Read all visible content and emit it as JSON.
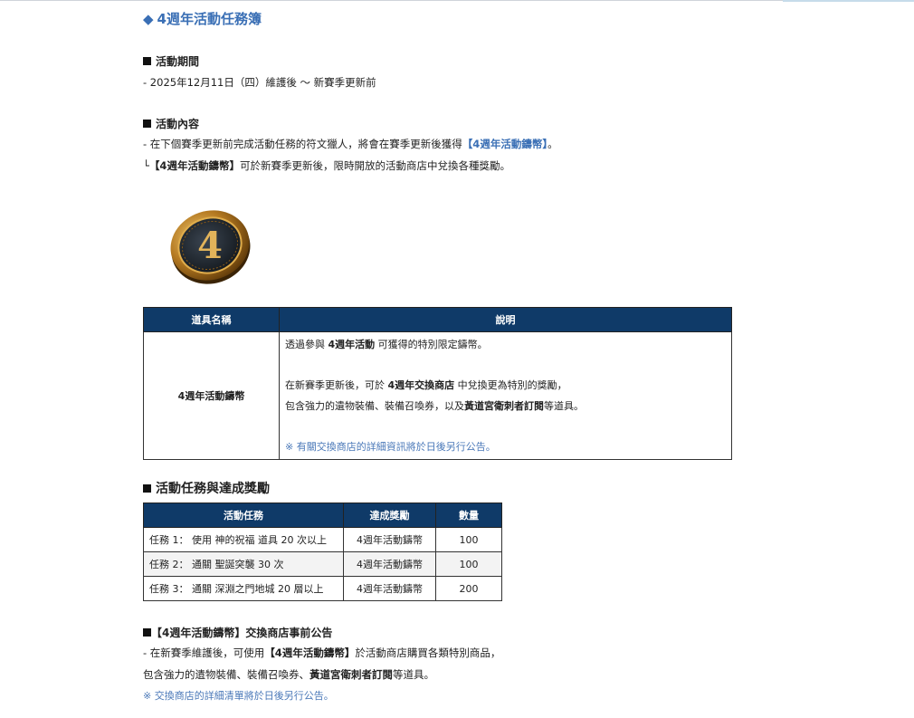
{
  "title": {
    "diamond": "◆",
    "text": "4週年活動任務簿"
  },
  "period": {
    "heading": "活動期間",
    "text": "- 2025年12月11日（四）維護後 ～ 新賽季更新前"
  },
  "content": {
    "heading": "活動內容",
    "line1_prefix": "- 在下個賽季更新前完成活動任務的符文獵人，將會在賽季更新後獲得",
    "line1_highlight": "【4週年活動鑄幣】",
    "line1_suffix": "。",
    "line2_prefix": "└",
    "line2_bold": "【4週年活動鑄幣】",
    "line2_suffix": "可於新賽季更新後，限時開放的活動商店中兌換各種獎勵。"
  },
  "coin": {
    "icon": "anniversary-coin-4",
    "numeral": "4",
    "gold": "#c8902f",
    "dark": "#1c2228"
  },
  "item_table": {
    "headers": [
      "道具名稱",
      "說明"
    ],
    "name": "4週年活動鑄幣",
    "desc1_a": "透過參與 ",
    "desc1_b": "4週年活動",
    "desc1_c": " 可獲得的特別限定鑄幣。",
    "desc2_a": "在新賽季更新後，可於 ",
    "desc2_b": "4週年交換商店",
    "desc2_c": " 中兌換更為特別的獎勵，",
    "desc3_a": "包含強力的遺物裝備、裝備召喚券，以及",
    "desc3_b": "黃道宮衛刺者訂閱",
    "desc3_c": "等道具。",
    "note": "※ 有關交換商店的詳細資訊將於日後另行公告。"
  },
  "missions": {
    "heading": "活動任務與達成獎勵",
    "headers": [
      "活動任務",
      "達成獎勵",
      "數量"
    ],
    "rows": [
      {
        "task": "任務 1： 使用 神的祝福 道具 20 次以上",
        "reward": "4週年活動鑄幣",
        "qty": "100"
      },
      {
        "task": "任務 2： 通關 聖誕突襲 30 次",
        "reward": "4週年活動鑄幣",
        "qty": "100"
      },
      {
        "task": "任務 3： 通關 深淵之門地城 20 層以上",
        "reward": "4週年活動鑄幣",
        "qty": "200"
      }
    ]
  },
  "shop": {
    "heading_bold": "【4週年活動鑄幣】",
    "heading_rest": "交換商店事前公告",
    "line1_a": "- 在新賽季維護後，可使用",
    "line1_b": "【4週年活動鑄幣】",
    "line1_c": "於活動商店購買各類特別商品，",
    "line2_a": "包含強力的遺物裝備、裝備召喚券、",
    "line2_b": "黃道宮衛刺者訂閱",
    "line2_c": "等道具。",
    "note": "※ 交換商店的詳細清單將於日後另行公告。"
  },
  "colors": {
    "accent_blue": "#3a6fb5",
    "header_navy": "#0f3a68"
  }
}
